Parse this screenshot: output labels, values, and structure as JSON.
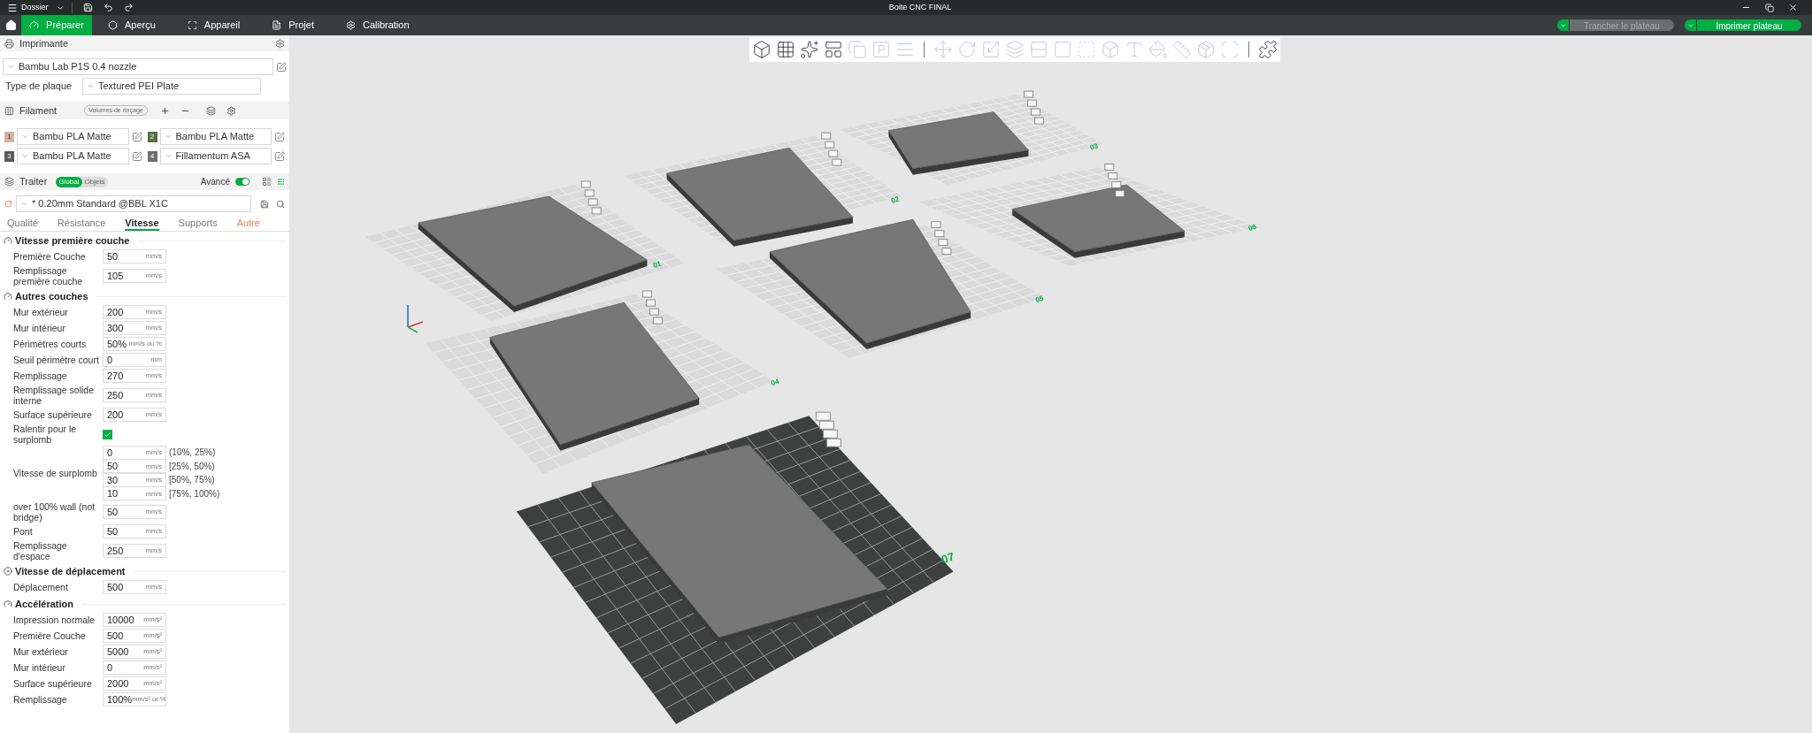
{
  "title_bar": {
    "menu": "Dossier",
    "title": "Boite CNC FINAL"
  },
  "tabs": [
    {
      "label": "Préparer",
      "selected": true,
      "kind": "prepare"
    },
    {
      "label": "Aperçu",
      "selected": false,
      "kind": "preview"
    },
    {
      "label": "Appareil",
      "selected": false,
      "kind": "device"
    },
    {
      "label": "Projet",
      "selected": false,
      "kind": "project"
    },
    {
      "label": "Calibration",
      "selected": false,
      "kind": "calibration"
    }
  ],
  "actions": [
    {
      "label": "Trancher le plateau",
      "disabled": true
    },
    {
      "label": "Imprimer plateau",
      "disabled": false
    }
  ],
  "printer": {
    "header": "Imprimante",
    "preset": "Bambu Lab P1S 0.4 nozzle",
    "plate_type_label": "Type de plaque",
    "plate_type": "Textured PEI Plate"
  },
  "filament": {
    "header": "Filament",
    "flush_button": "Volumes de rinçage",
    "slots": [
      {
        "number": "1",
        "name": "Bambu PLA Matte",
        "color": "#d4b2a2"
      },
      {
        "number": "2",
        "name": "Bambu PLA Matte",
        "color": "#5e6b48"
      },
      {
        "number": "3",
        "name": "Bambu PLA Matte",
        "color": "#595959"
      },
      {
        "number": "4",
        "name": "Fillamentum ASA",
        "color": "#6e6e6e"
      }
    ]
  },
  "process": {
    "header": "Traiter",
    "scope": [
      {
        "label": "Global",
        "selected": true
      },
      {
        "label": "Objets",
        "selected": false
      }
    ],
    "advanced": {
      "label": "Avancé",
      "on": true
    },
    "preset": "* 0.20mm Standard @BBL X1C",
    "tabs": [
      {
        "label": "Qualité",
        "selected": false,
        "modified": false
      },
      {
        "label": "Résistance",
        "selected": false,
        "modified": false
      },
      {
        "label": "Vitesse",
        "selected": true,
        "modified": false
      },
      {
        "label": "Supports",
        "selected": false,
        "modified": false
      },
      {
        "label": "Autre",
        "selected": false,
        "modified": true
      }
    ]
  },
  "sections": [
    {
      "title": "Vitesse première couche",
      "rows": [
        {
          "kind": "field",
          "label": "Première Couche",
          "value": "50",
          "unit": "mm/s"
        },
        {
          "kind": "field",
          "label": "Remplissage première couche",
          "value": "105",
          "unit": "mm/s"
        }
      ]
    },
    {
      "title": "Autres couches",
      "rows": [
        {
          "kind": "field",
          "label": "Mur extérieur",
          "value": "200",
          "unit": "mm/s"
        },
        {
          "kind": "field",
          "label": "Mur intérieur",
          "value": "300",
          "unit": "mm/s"
        },
        {
          "kind": "field",
          "label": "Périmètres courts",
          "value": "50%",
          "unit": "mm/s ou %"
        },
        {
          "kind": "field",
          "label": "Seuil périmètre court",
          "value": "0",
          "unit": "mm"
        },
        {
          "kind": "field",
          "label": "Remplissage",
          "value": "270",
          "unit": "mm/s"
        },
        {
          "kind": "field",
          "label": "Remplissage solide interne",
          "value": "250",
          "unit": "mm/s"
        },
        {
          "kind": "field",
          "label": "Surface supérieure",
          "value": "200",
          "unit": "mm/s"
        },
        {
          "kind": "checkbox",
          "label": "Ralentir pour le surplomb",
          "checked": true
        },
        {
          "kind": "multi",
          "label": "Vitesse de surplomb",
          "fields": [
            {
              "value": "0",
              "unit": "mm/s",
              "range": "(10%, 25%)"
            },
            {
              "value": "50",
              "unit": "mm/s",
              "range": "[25%, 50%)"
            },
            {
              "value": "30",
              "unit": "mm/s",
              "range": "[50%, 75%)"
            },
            {
              "value": "10",
              "unit": "mm/s",
              "range": "[75%, 100%)"
            }
          ]
        },
        {
          "kind": "field",
          "label": "over 100% wall (not bridge)",
          "value": "50",
          "unit": "mm/s"
        },
        {
          "kind": "field",
          "label": "Pont",
          "value": "50",
          "unit": "mm/s"
        },
        {
          "kind": "field",
          "label": "Remplissage d'espace",
          "value": "250",
          "unit": "mm/s"
        }
      ]
    },
    {
      "title": "Vitesse de déplacement",
      "rows": [
        {
          "kind": "field",
          "label": "Déplacement",
          "value": "500",
          "unit": "mm/s"
        }
      ]
    },
    {
      "title": "Accélération",
      "rows": [
        {
          "kind": "field",
          "label": "Impression normale",
          "value": "10000",
          "unit": "mm/s²"
        },
        {
          "kind": "field",
          "label": "Première Couche",
          "value": "500",
          "unit": "mm/s²"
        },
        {
          "kind": "field",
          "label": "Mur extérieur",
          "value": "5000",
          "unit": "mm/s²"
        },
        {
          "kind": "field",
          "label": "Mur intérieur",
          "value": "0",
          "unit": "mm/s²"
        },
        {
          "kind": "field",
          "label": "Surface supérieure",
          "value": "2000",
          "unit": "mm/s²"
        },
        {
          "kind": "field",
          "label": "Remplissage",
          "value": "100%",
          "unit": "mm/s² or %"
        }
      ]
    }
  ],
  "viewport": {
    "plates": [
      {
        "label": "01",
        "selected": false
      },
      {
        "label": "02",
        "selected": false
      },
      {
        "label": "03",
        "selected": false
      },
      {
        "label": "04",
        "selected": false
      },
      {
        "label": "05",
        "selected": false
      },
      {
        "label": "06",
        "selected": false
      },
      {
        "label": "07",
        "selected": true
      }
    ]
  }
}
